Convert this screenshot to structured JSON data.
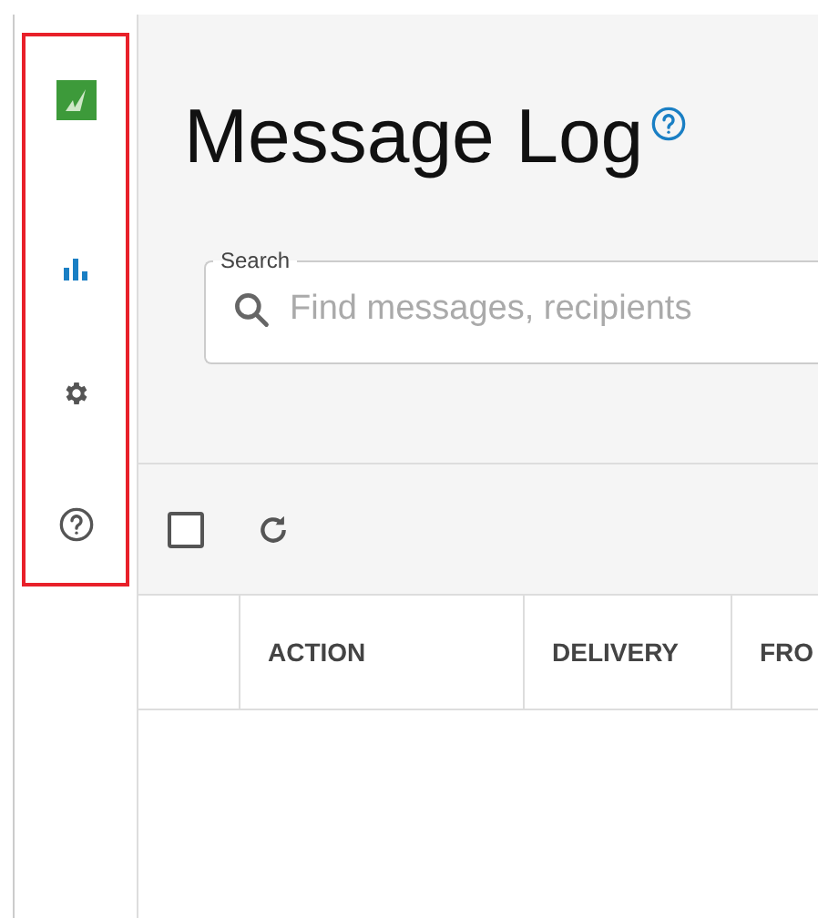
{
  "sidebar": {
    "highlighted": true,
    "items": [
      {
        "kind": "reports",
        "selected": true
      },
      {
        "kind": "settings",
        "selected": false
      },
      {
        "kind": "help",
        "selected": false
      }
    ]
  },
  "page": {
    "title": "Message Log"
  },
  "search": {
    "label": "Search",
    "placeholder": "Find messages, recipients"
  },
  "toolbar": {
    "select_all": {
      "checked": false
    }
  },
  "table": {
    "columns": [
      "ACTION",
      "DELIVERY",
      "FRO"
    ]
  }
}
